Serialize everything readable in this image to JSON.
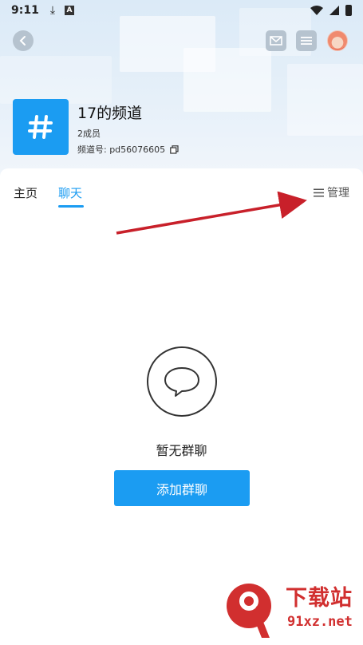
{
  "status_bar": {
    "time": "9:11"
  },
  "header": {
    "back_icon": "chevron-left-icon",
    "mail_icon": "mail-icon",
    "menu_icon": "menu-icon",
    "avatar_icon": "user-avatar"
  },
  "channel": {
    "title": "17的频道",
    "members": "2成员",
    "id_label": "频道号: pd56076605",
    "icon": "hash-icon",
    "icon_color": "#1b9cf2"
  },
  "tabs": [
    {
      "label": "主页",
      "active": false
    },
    {
      "label": "聊天",
      "active": true
    }
  ],
  "manage_label": "管理",
  "empty_state": {
    "text": "暂无群聊",
    "button_label": "添加群聊"
  },
  "watermark": {
    "brand": "下载站",
    "url": "91xz.net"
  },
  "colors": {
    "accent": "#1b9cf2",
    "annotation_arrow": "#c8202a"
  }
}
